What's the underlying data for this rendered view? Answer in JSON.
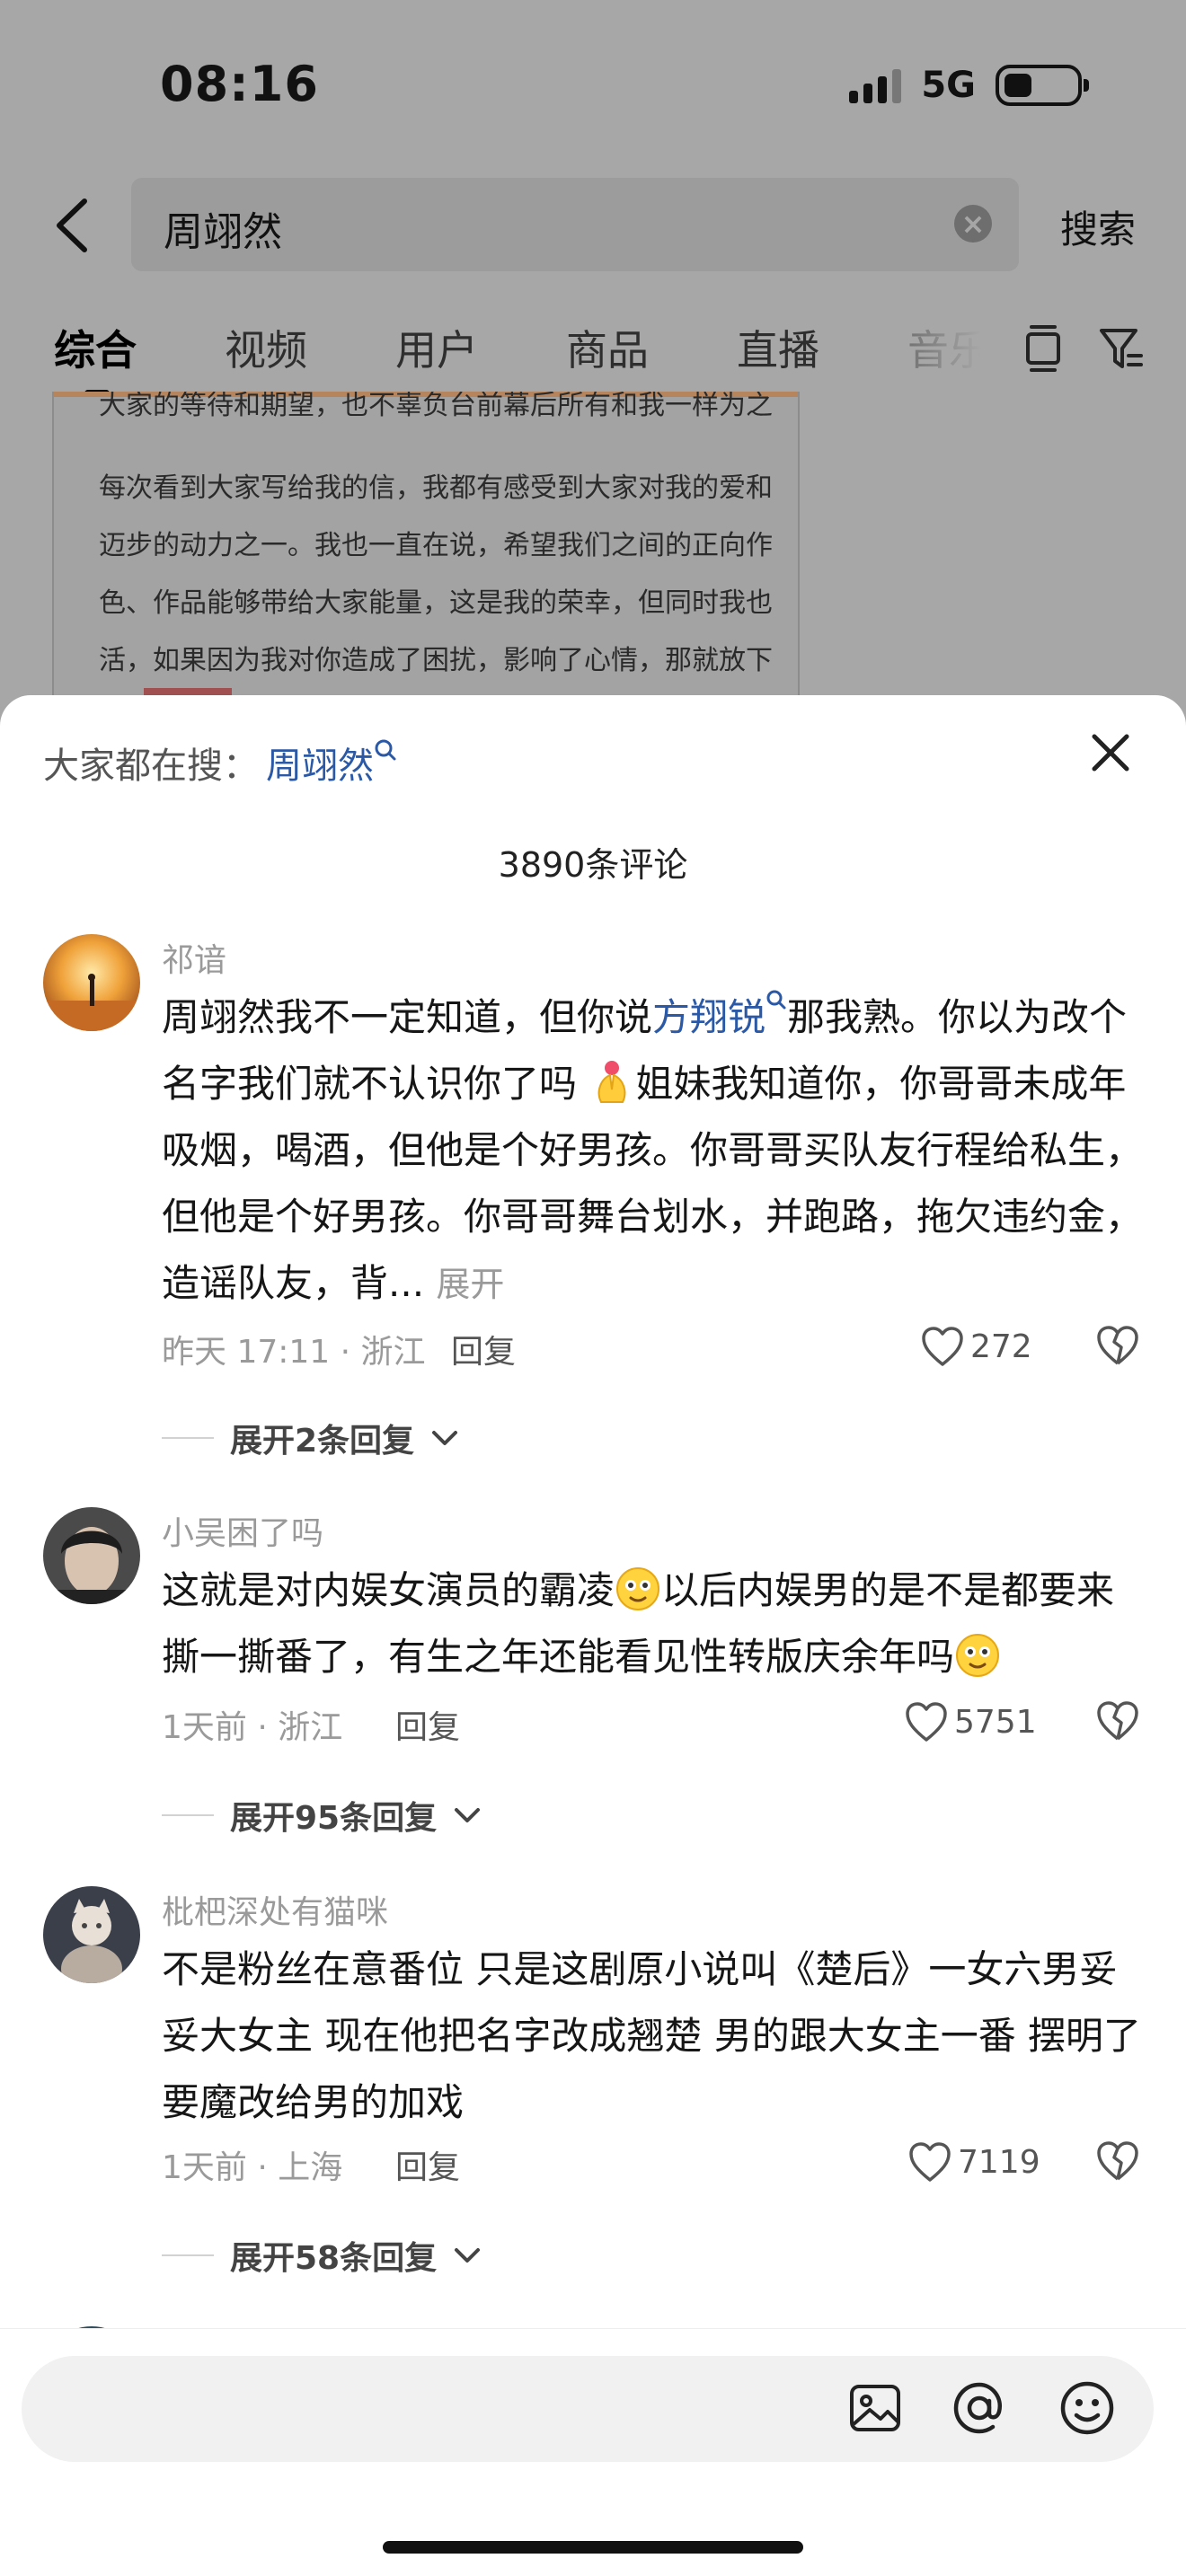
{
  "status_bar": {
    "time": "08:16",
    "network": "5G"
  },
  "search": {
    "query": "周翊然",
    "button_label": "搜索"
  },
  "tabs": [
    {
      "label": "综合",
      "active": true
    },
    {
      "label": "视频",
      "active": false
    },
    {
      "label": "用户",
      "active": false
    },
    {
      "label": "商品",
      "active": false
    },
    {
      "label": "直播",
      "active": false
    },
    {
      "label": "音乐",
      "active": false
    }
  ],
  "background_doc": {
    "lines": [
      "大家的等待和期望，也不辜负台前幕后所有和我一样为之",
      "每次看到大家写给我的信，我都有感受到大家对我的爱和",
      "迈步的动力之一。我也一直在说，希望我们之间的正向作",
      "色、作品能够带给大家能量，这是我的荣幸，但同时我也",
      "活，如果因为我对你造成了困扰，影响了心情，那就放下"
    ]
  },
  "sheet": {
    "trending_label": "大家都在搜：",
    "trending_term": "周翊然",
    "comment_count": "3890条评论"
  },
  "comments": [
    {
      "username": "祁谙",
      "text_1": "周翊然我不一定知道，但你说",
      "link": "方翔锐",
      "text_2": "那我熟。你以为改个名字我们就不认识你了吗",
      "text_3": "姐妹我知道你，你哥哥未成年吸烟，喝酒，但他是个好男孩。你哥哥买队友行程给私生，但他是个好男孩。你哥哥舞台划水，并跑路，拖欠违约金，造谣队友，背...",
      "more": "展开",
      "time_location": "昨天 17:11 · 浙江",
      "reply": "回复",
      "likes": "272",
      "expand": "展开2条回复"
    },
    {
      "username": "小吴困了吗",
      "text_1": "这就是对内娱女演员的霸凌",
      "text_2": "以后内娱男的是不是都要来撕一撕番了，有生之年还能看见性转版庆余年吗",
      "time_location": "1天前 · 浙江",
      "reply": "回复",
      "likes": "5751",
      "expand": "展开95条回复"
    },
    {
      "username": "枇杷深处有猫咪",
      "text_1": "不是粉丝在意番位 只是这剧原小说叫《楚后》一女六男妥妥大女主 现在他把名字改成翘楚 男的跟大女主一番 摆明了要魔改给男的加戏",
      "time_location": "1天前 · 上海",
      "reply": "回复",
      "likes": "7119",
      "expand": "展开58条回复"
    }
  ],
  "icons": [
    "back-arrow-icon",
    "clear-icon",
    "layout-icon",
    "filter-icon",
    "close-icon",
    "heart-icon",
    "broken-heart-icon",
    "chevron-down-icon",
    "image-icon",
    "at-icon",
    "emoji-icon"
  ],
  "colors": {
    "link": "#2b59a6",
    "dim_overlay": "#a7a7a7",
    "secondary_text": "#9a9a9a"
  }
}
